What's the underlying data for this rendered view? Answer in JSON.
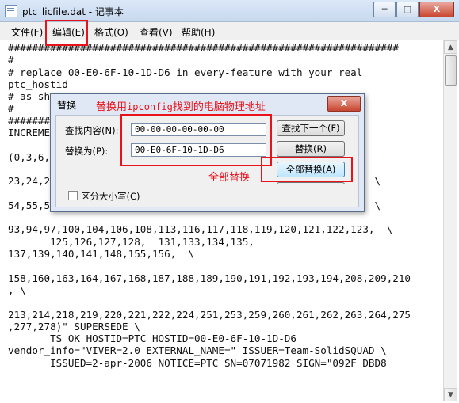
{
  "window": {
    "title": "ptc_licfile.dat - 记事本",
    "buttons": {
      "minimize": "─",
      "maximize": "□",
      "close": "X"
    }
  },
  "menubar": {
    "items": [
      {
        "label": "文件(F)"
      },
      {
        "label": "编辑(E)"
      },
      {
        "label": "格式(O)"
      },
      {
        "label": "查看(V)"
      },
      {
        "label": "帮助(H)"
      }
    ]
  },
  "editor": {
    "lines": [
      "#################################################################",
      "#",
      "# replace 00-E0-6F-10-1D-D6 in every-feature with your real",
      "ptc_hostid",
      "# as sh",
      "#",
      "########",
      "INCREME",
      "",
      "(0,3,6,",
      "",
      "23,24,2                                                 53,  \\",
      "",
      "54,55,5                                                 92,  \\",
      "",
      "93,94,97,100,104,106,108,113,116,117,118,119,120,121,122,123,  \\",
      "       125,126,127,128,  131,133,134,135,",
      "137,139,140,141,148,155,156,  \\",
      "",
      "158,160,163,164,167,168,187,188,189,190,191,192,193,194,208,209,210",
      ", \\",
      "",
      "213,214,218,219,220,221,222,224,251,253,259,260,261,262,263,264,275",
      ",277,278)\" SUPERSEDE \\",
      "       TS_OK HOSTID=PTC_HOSTID=00-E0-6F-10-1D-D6",
      "vendor_info=\"VIVER=2.0 EXTERNAL_NAME=\" ISSUER=Team-SolidSQUAD \\",
      "       ISSUED=2-apr-2006 NOTICE=PTC SN=07071982 SIGN=\"092F DBD8"
    ]
  },
  "scrollbar": {
    "up_arrow": "▲",
    "down_arrow": "▼"
  },
  "dialog": {
    "title": "替换",
    "close": "X",
    "find_label": "查找内容(N):",
    "find_value": "00-00-00-00-00-00",
    "replace_label": "替换为(P):",
    "replace_value": "00-E0-6F-10-1D-D6",
    "find_next_button": "查找下一个(F)",
    "replace_button": "替换(R)",
    "replace_all_button": "全部替换(A)",
    "match_case_label": "区分大小写(C)",
    "match_case_checked": false
  },
  "annotations": {
    "title_note_prefix": "替换用",
    "title_note_mono": "ipconfig",
    "title_note_suffix": "找到的电脑物理地址",
    "replace_all_note": "全部替换",
    "color": "#e8121a"
  }
}
